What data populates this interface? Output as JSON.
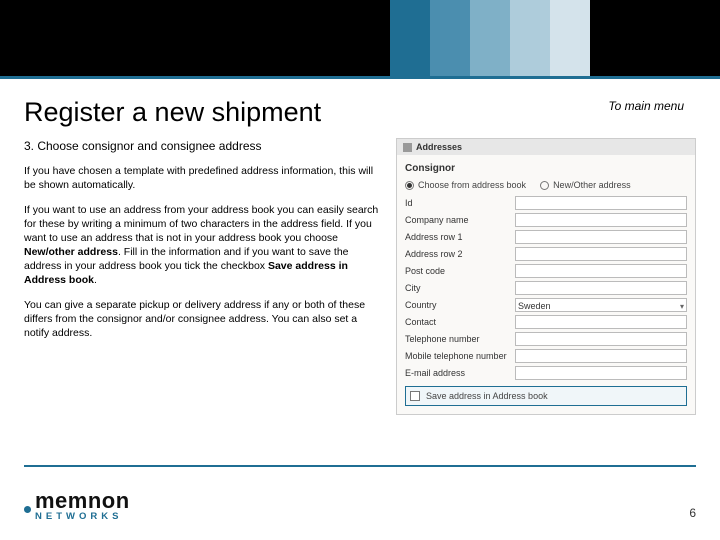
{
  "header": {
    "title": "Register a new shipment",
    "main_menu_link": "To main menu"
  },
  "content": {
    "step_title": "3. Choose consignor and consignee address",
    "p1": "If you have chosen a template with predefined address information, this will be shown automatically.",
    "p2a": "If you want to use an address from your address book you can easily search for these by writing a minimum of two characters in the address field. If you want to use an address that is not in your address book you choose ",
    "p2b": "New/other address",
    "p2c": ". Fill in the information and if you want to save the address in your address book you tick the checkbox ",
    "p2d": "Save address in Address book",
    "p2e": ".",
    "p3": "You can give a separate pickup or delivery address if any or both of these differs from the consignor and/or consignee address.  You can also set a notify address."
  },
  "form": {
    "panel_title": "Addresses",
    "section_title": "Consignor",
    "radio_book": "Choose from address book",
    "radio_new": "New/Other address",
    "fields": {
      "id": "Id",
      "company": "Company name",
      "addr1": "Address row 1",
      "addr2": "Address row 2",
      "postcode": "Post code",
      "city": "City",
      "country": "Country",
      "country_value": "Sweden",
      "contact": "Contact",
      "tel": "Telephone number",
      "mobile": "Mobile telephone number",
      "email": "E-mail address"
    },
    "save_checkbox": "Save address in Address book"
  },
  "footer": {
    "brand_main": "memnon",
    "brand_sub": "NETWORKS",
    "page": "6"
  }
}
